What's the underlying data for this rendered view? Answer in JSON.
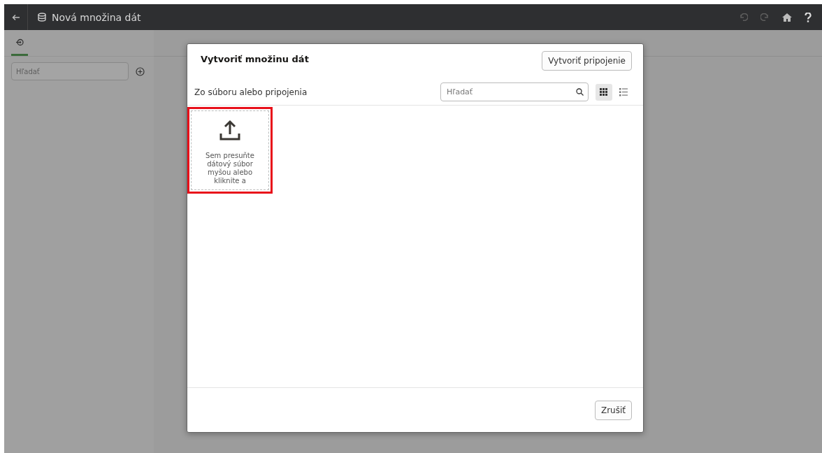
{
  "header": {
    "title": "Nová množina dát"
  },
  "sidebar": {
    "search": {
      "placeholder": "Hľadať"
    }
  },
  "dialog": {
    "title": "Vytvoriť množinu dát",
    "create_connection_button": "Vytvoriť pripojenie",
    "subtitle": "Zo súboru alebo pripojenia",
    "search": {
      "placeholder": "Hľadať"
    },
    "views": [
      {
        "kind": "grid",
        "selected": true
      },
      {
        "kind": "list",
        "selected": false
      }
    ],
    "upload_tile": {
      "text": "Sem presuňte dátový súbor myšou alebo kliknite a",
      "highlighted": true
    },
    "cancel_button": "Zrušiť"
  }
}
